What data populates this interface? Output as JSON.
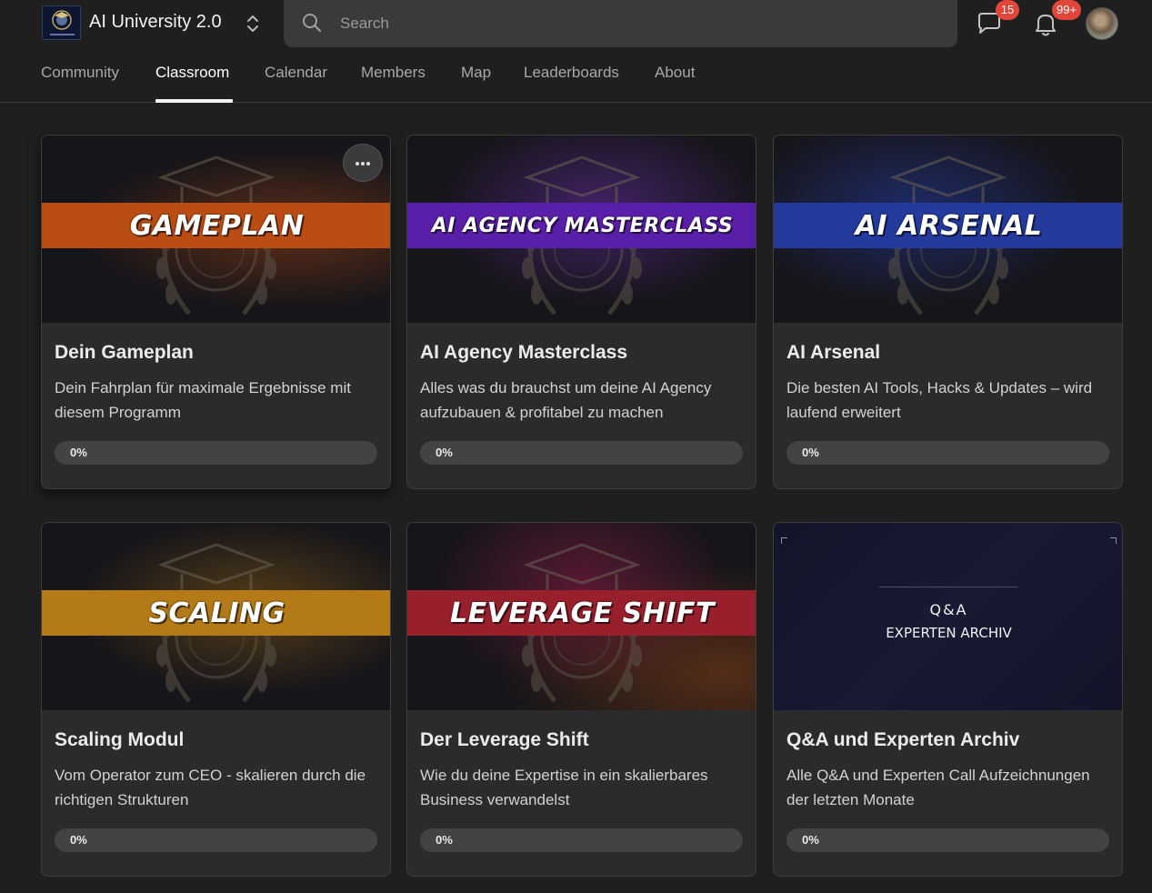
{
  "header": {
    "group_name": "AI University 2.0",
    "logo_text": "AI UNIVERSITY",
    "search_placeholder": "Search",
    "chat_badge": "15",
    "notifications_badge": "99+"
  },
  "tabs": [
    {
      "label": "Community",
      "active": false
    },
    {
      "label": "Classroom",
      "active": true
    },
    {
      "label": "Calendar",
      "active": false
    },
    {
      "label": "Members",
      "active": false
    },
    {
      "label": "Map",
      "active": false
    },
    {
      "label": "Leaderboards",
      "active": false
    },
    {
      "label": "About",
      "active": false
    }
  ],
  "courses": [
    {
      "banner": "GAMEPLAN",
      "banner_color": "#b94d14",
      "title": "Dein Gameplan",
      "description": "Dein Fahrplan für maximale Ergebnisse mit diesem Programm",
      "progress": 0,
      "progress_label": "0%"
    },
    {
      "banner": "AI AGENCY MASTERCLASS",
      "banner_color": "#5a1fa8",
      "title": "AI Agency Masterclass",
      "description": "Alles was du brauchst um deine AI Agency aufzubauen & profitabel zu machen",
      "progress": 0,
      "progress_label": "0%"
    },
    {
      "banner": "AI ARSENAL",
      "banner_color": "#243a9c",
      "title": "AI Arsenal",
      "description": "Die besten AI Tools, Hacks & Updates – wird laufend erweitert",
      "progress": 0,
      "progress_label": "0%"
    },
    {
      "banner": "SCALING",
      "banner_color": "#b37a17",
      "title": "Scaling Modul",
      "description": "Vom Operator zum CEO - skalieren durch die richtigen Strukturen",
      "progress": 0,
      "progress_label": "0%"
    },
    {
      "banner": "LEVERAGE SHIFT",
      "banner_color": "#98202d",
      "title": "Der Leverage Shift",
      "description": "Wie du deine Expertise in ein skalierbares Business verwandelst",
      "progress": 0,
      "progress_label": "0%"
    },
    {
      "banner_line1": "Q&A",
      "banner_line2": "EXPERTEN ARCHIV",
      "title": "Q&A und Experten Archiv",
      "description": "Alle Q&A und Experten Call Aufzeichnungen der letzten Monate",
      "progress": 0,
      "progress_label": "0%"
    }
  ]
}
